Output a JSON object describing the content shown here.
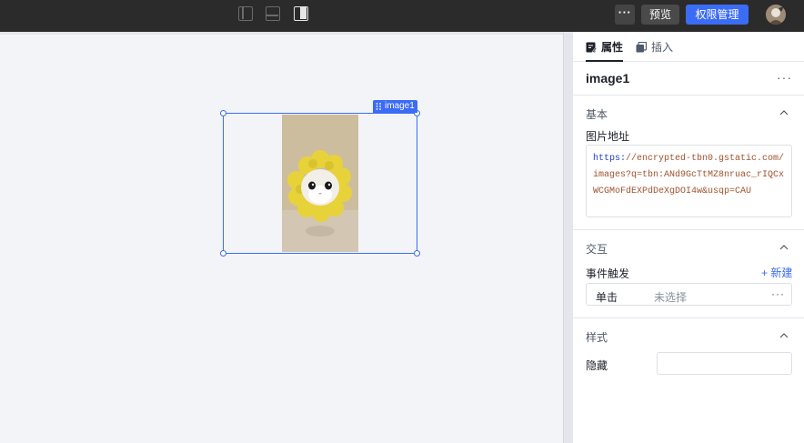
{
  "toolbar": {
    "more_label": "···",
    "preview_label": "预览",
    "permission_label": "权限管理",
    "accent_color": "#3b6cf6"
  },
  "canvas": {
    "selected_component_tag": "image1"
  },
  "panel": {
    "tabs": [
      {
        "label": "属性",
        "icon": "properties-icon",
        "active": true
      },
      {
        "label": "插入",
        "icon": "insert-icon",
        "active": false
      }
    ],
    "component_name": "image1",
    "component_more": "···",
    "sections": {
      "basic": {
        "title": "基本",
        "image_url_label": "图片地址",
        "image_url_protocol": "https:",
        "image_url_rest": "//encrypted-tbn0.gstatic.com/images?q=tbn:ANd9GcTtMZ8nruac_rIQCxWCGMoFdEXPdDeXgDOI4w&usqp=CAU"
      },
      "interaction": {
        "title": "交互",
        "event_trigger_label": "事件触发",
        "new_label": "+ 新建",
        "event": {
          "name": "单击",
          "value": "未选择",
          "more": "···"
        }
      },
      "style": {
        "title": "样式",
        "hidden_label": "隐藏",
        "hidden_value": ""
      }
    }
  }
}
